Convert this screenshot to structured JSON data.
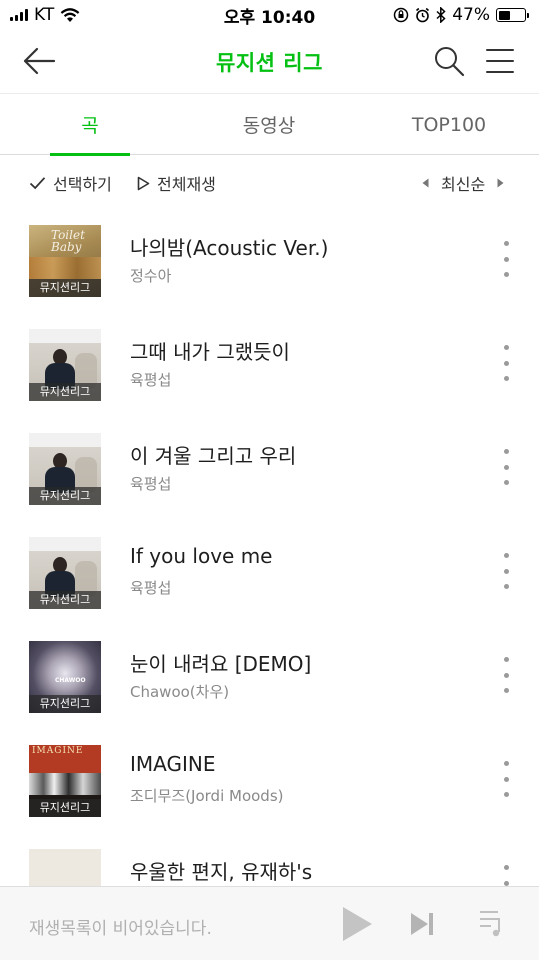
{
  "status_bar": {
    "carrier": "KT",
    "time": "오후 10:40",
    "battery": "47%",
    "battery_level": 0.47
  },
  "header": {
    "title": "뮤지션 리그",
    "back_icon": "back-arrow-icon",
    "search_icon": "search-icon",
    "menu_icon": "hamburger-menu-icon"
  },
  "tabs": [
    {
      "label": "곡",
      "active": true
    },
    {
      "label": "동영상",
      "active": false
    },
    {
      "label": "TOP100",
      "active": false
    }
  ],
  "toolbar": {
    "select_label": "선택하기",
    "play_all_label": "전체재생",
    "sort_label": "최신순"
  },
  "songs": [
    {
      "title": "나의밤(Acoustic Ver.)",
      "artist": "정수아",
      "badge": "뮤지션리그",
      "art_text": "Toilet Baby"
    },
    {
      "title": "그때 내가 그랬듯이",
      "artist": "육평섭",
      "badge": "뮤지션리그"
    },
    {
      "title": "이 겨울 그리고 우리",
      "artist": "육평섭",
      "badge": "뮤지션리그"
    },
    {
      "title": "If you love me",
      "artist": "육평섭",
      "badge": "뮤지션리그"
    },
    {
      "title": "눈이 내려요 [DEMO]",
      "artist": "Chawoo(차우)",
      "badge": "뮤지션리그",
      "art_text": "CHAWOO"
    },
    {
      "title": "IMAGINE",
      "artist": "조디무즈(Jordi Moods)",
      "badge": "뮤지션리그",
      "art_text": "IMAGINE"
    },
    {
      "title": "우울한 편지, 유재하's",
      "artist": "",
      "badge": ""
    }
  ],
  "player": {
    "empty_text": "재생목록이 비어있습니다."
  },
  "colors": {
    "accent": "#04c012",
    "text": "#1e1e1e",
    "subtext": "#8a8a8a"
  }
}
